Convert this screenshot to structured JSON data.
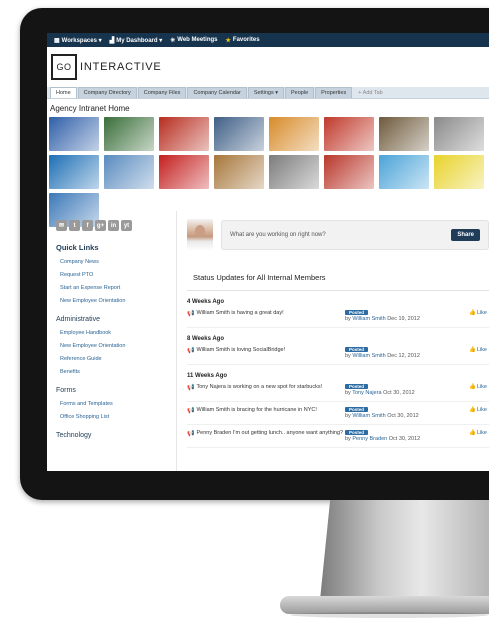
{
  "topbar": {
    "items": [
      {
        "label": "Workspaces ▾",
        "icon": "grid-icon"
      },
      {
        "label": "My Dashboard ▾",
        "icon": "chart-icon"
      },
      {
        "label": "Web Meetings",
        "icon": "globe-icon"
      },
      {
        "label": "Favorites",
        "icon": "star-icon"
      }
    ]
  },
  "logo": {
    "box": "GO",
    "text": "INTERACTIVE"
  },
  "tabs": [
    "Home",
    "Company Directory",
    "Company Files",
    "Company Calendar",
    "Settings ▾",
    "People",
    "Properties",
    "+ Add Tab"
  ],
  "page_title": "Agency Intranet Home",
  "photos": [
    "#2f5fa8",
    "#3a6e3a",
    "#b72d1f",
    "#3f5f86",
    "#d78b2a",
    "#c0392b",
    "#6e5a3c",
    "#8a8a8a",
    "#1d6fb5",
    "#5a8bbf",
    "#c41f1f",
    "#a6763a",
    "#7c7c7c",
    "#b9362a",
    "#4aa3d8",
    "#e8d32a",
    "#3c78b8"
  ],
  "social": [
    "✉",
    "t",
    "f",
    "g+",
    "in",
    "yt"
  ],
  "quick_links": {
    "title": "Quick Links",
    "items": [
      "Company News",
      "Request PTO",
      "Start an Expense Report",
      "New Employee Orientation"
    ]
  },
  "administrative": {
    "title": "Administrative",
    "items": [
      "Employee Handbook",
      "New Employee Orientation",
      "Reference Guide",
      "Benefits"
    ]
  },
  "forms": {
    "title": "Forms",
    "items": [
      "Forms and Templates",
      "Office Shopping List"
    ]
  },
  "technology": {
    "title": "Technology"
  },
  "post": {
    "placeholder": "What are you working on right now?",
    "share": "Share"
  },
  "status_title": "Status Updates for All Internal Members",
  "groups": [
    {
      "label": "4 Weeks Ago",
      "updates": [
        {
          "text": "William Smith is having a great day!",
          "name": "William Smith",
          "date": "Dec 19, 2012"
        }
      ]
    },
    {
      "label": "8 Weeks Ago",
      "updates": [
        {
          "text": "William Smith is loving SocialBridge!",
          "name": "William Smith",
          "date": "Dec 12, 2012"
        }
      ]
    },
    {
      "label": "11 Weeks Ago",
      "updates": [
        {
          "text": "Tony Najera is working on a new spot for starbucks!",
          "name": "Tony Najera",
          "date": "Oct 30, 2012"
        },
        {
          "text": "William Smith is bracing for the hurricane in NYC!",
          "name": "William Smith",
          "date": "Oct 30, 2012"
        },
        {
          "text": "Penny Braden I'm out getting lunch.. anyone want anything?",
          "name": "Penny Braden",
          "date": "Oct 30, 2012"
        }
      ]
    }
  ],
  "posted_label": "Posted",
  "by_label": "by",
  "like_label": "Like"
}
